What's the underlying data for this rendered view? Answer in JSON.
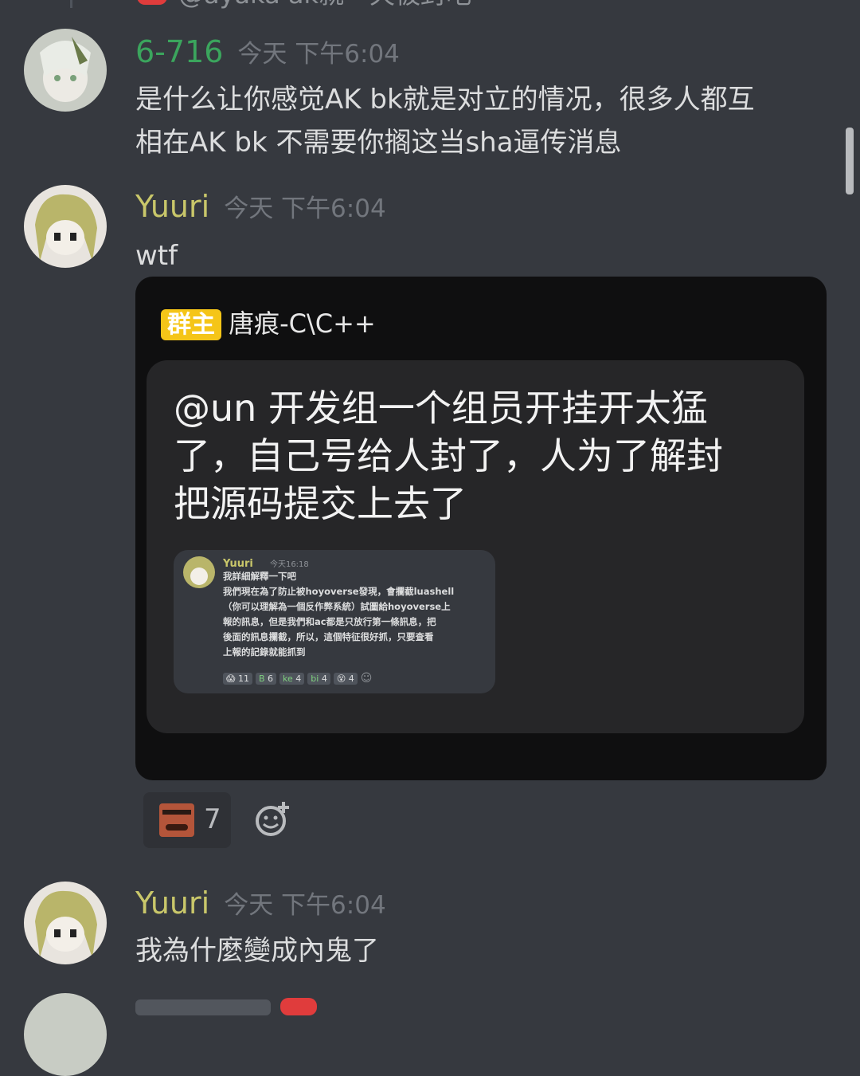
{
  "top_partial": {
    "text": "@ayaka  ak就一天被封吧"
  },
  "messages": [
    {
      "username": "6-716",
      "color": "#3ba55d",
      "time": "今天 下午6:04",
      "lines": [
        "是什么让你感觉AK bk就是对立的情况，很多人都互",
        "相在AK bk  不需要你搁这当sha逼传消息"
      ]
    },
    {
      "username": "Yuuri",
      "color": "#c9c76a",
      "time": "今天 下午6:04",
      "text": "wtf",
      "embed": {
        "badge": "群主",
        "author": "唐痕-C\\C++",
        "lines": [
          "@un 开发组一个组员开挂开太猛",
          "了，自己号给人封了，人为了解封",
          "把源码提交上去了"
        ],
        "mini": {
          "username": "Yuuri",
          "time": "今天16:18",
          "lines": [
            "我詳細解釋一下吧",
            "我們現在為了防止被hoyoverse發現，會攔截luashell",
            "（你可以理解為一個反作弊系統）試圖給hoyoverse上",
            "報的訊息，但是我們和ac都是只放行第一條訊息，把",
            "後面的訊息攔截，所以，這個特征很好抓，只要查看",
            "上報的記錄就能抓到"
          ],
          "reactions": [
            {
              "e": "😱",
              "n": "11"
            },
            {
              "e": "B",
              "n": "6"
            },
            {
              "e": "ke",
              "n": "4"
            },
            {
              "e": "bi",
              "n": "4"
            },
            {
              "e": "😵",
              "n": "4"
            }
          ]
        }
      },
      "reaction": {
        "count": "7"
      }
    },
    {
      "username": "Yuuri",
      "color": "#c9c76a",
      "time": "今天 下午6:04",
      "text": "我為什麼變成內鬼了"
    }
  ]
}
